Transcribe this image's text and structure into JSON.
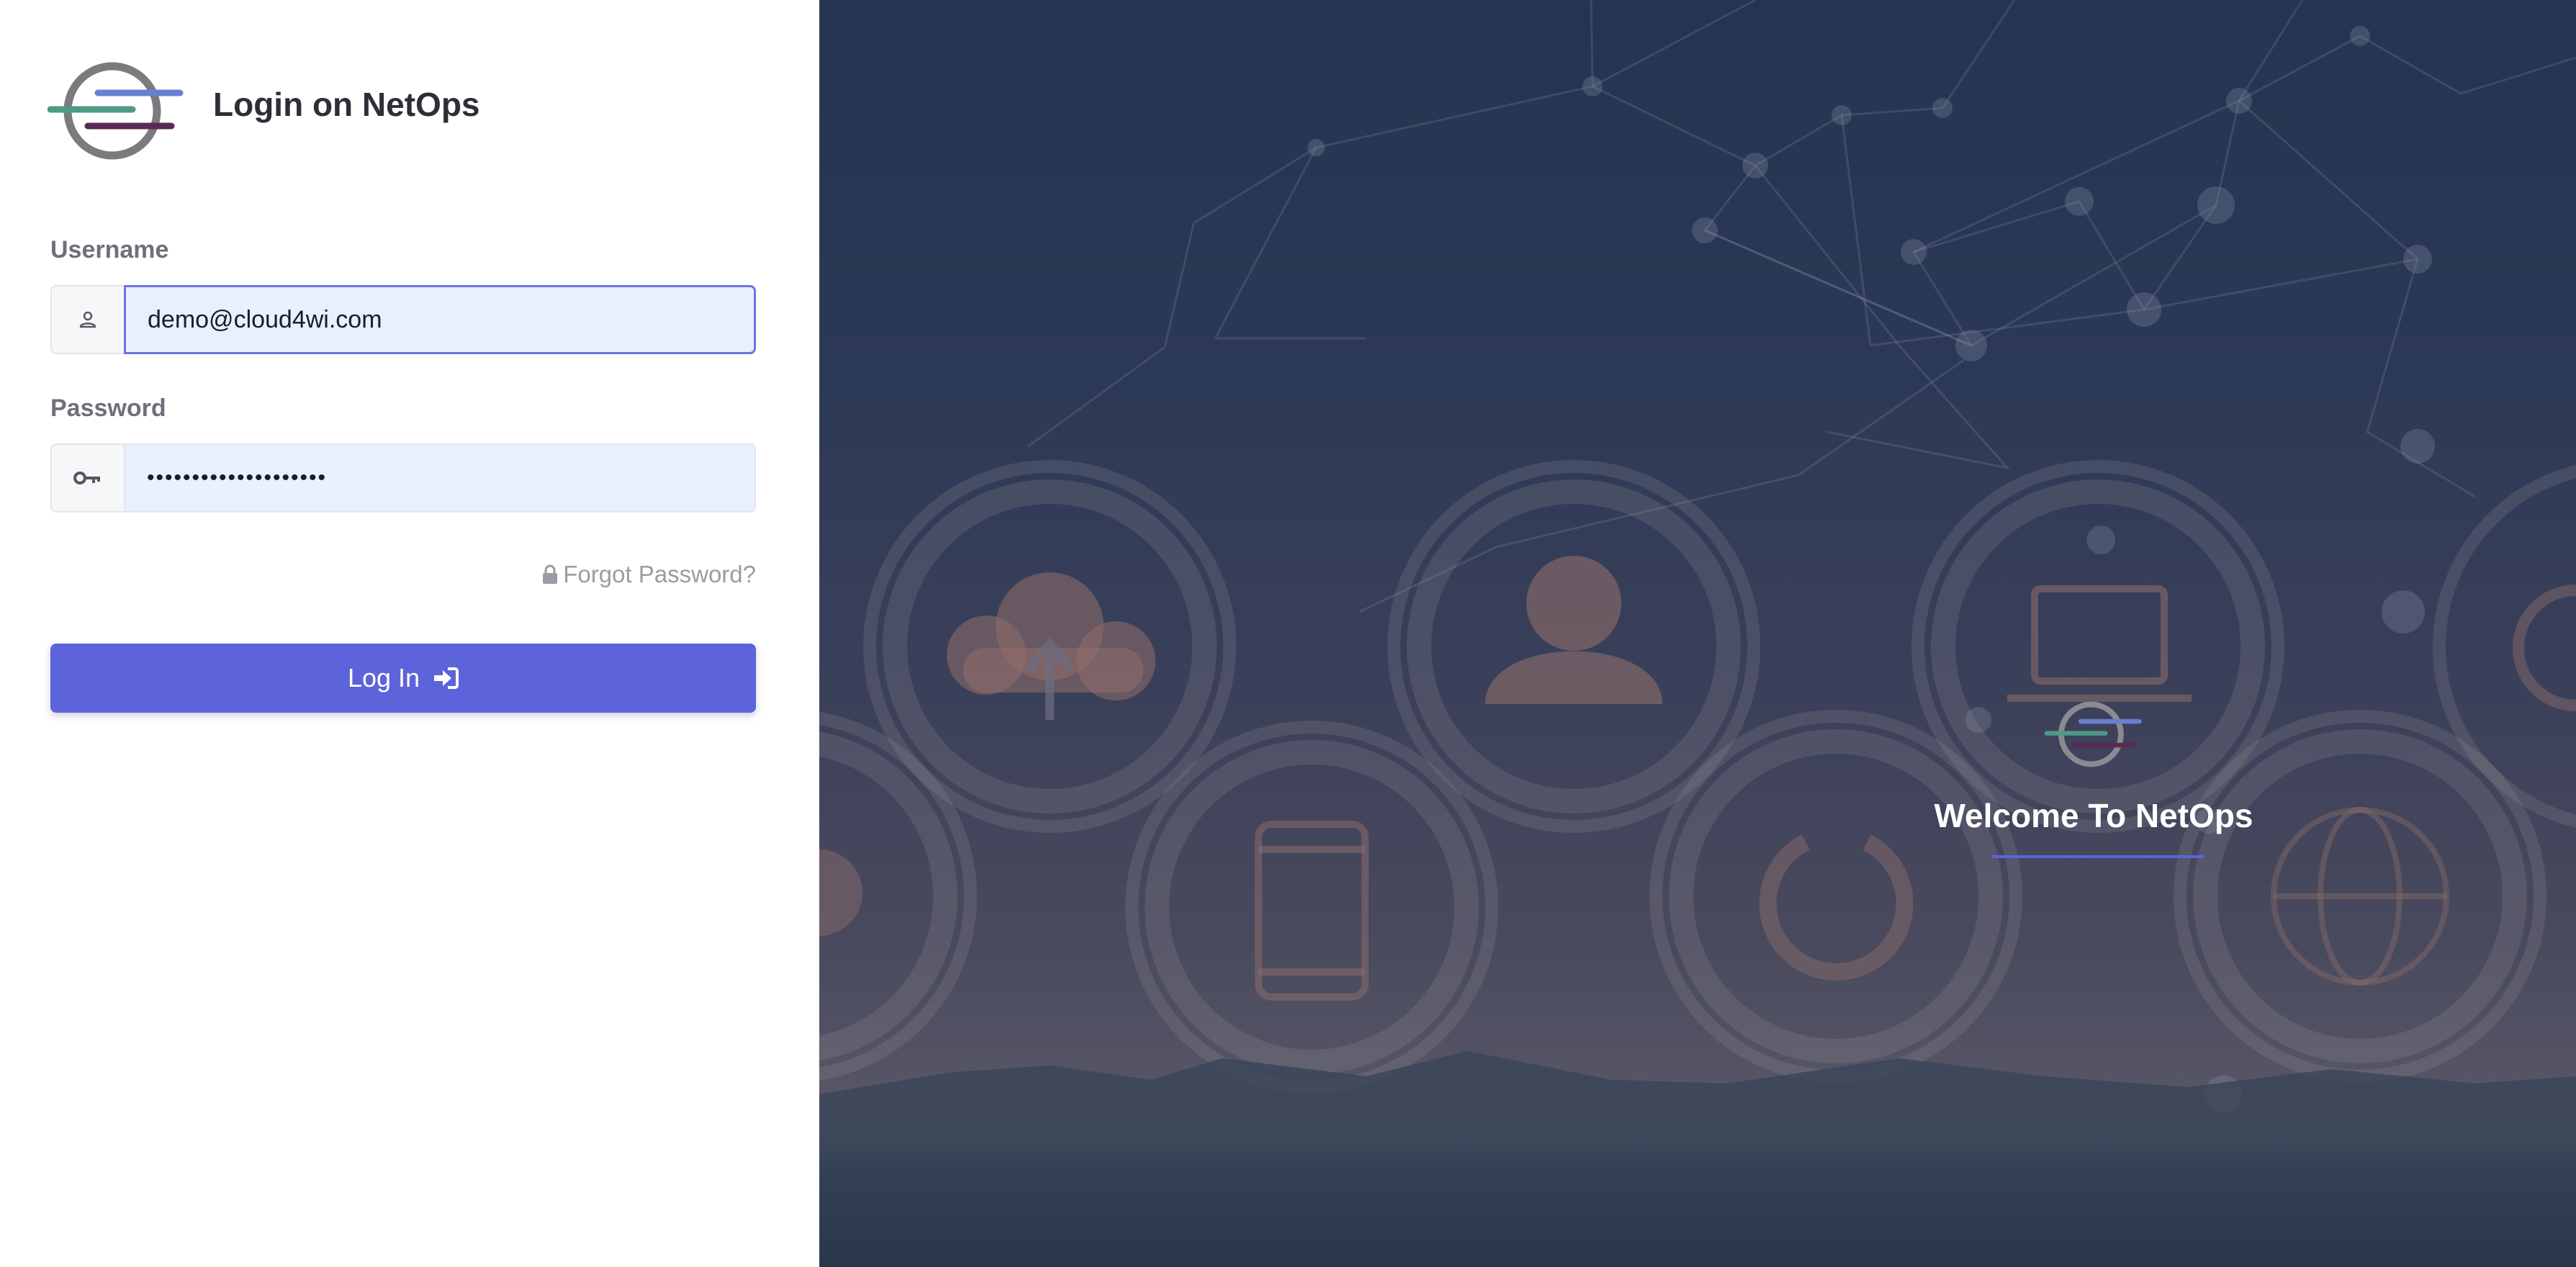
{
  "app": {
    "page_title": "Login on NetOps",
    "welcome_title": "Welcome To NetOps"
  },
  "form": {
    "username": {
      "label": "Username",
      "value": "demo@cloud4wi.com",
      "icon": "user-icon"
    },
    "password": {
      "label": "Password",
      "value": "••••••••••••••••••••",
      "icon": "key-icon"
    },
    "forgot_password": {
      "label": "Forgot Password?",
      "icon": "lock-icon"
    },
    "login_button": {
      "label": "Log In",
      "icon": "sign-in-icon"
    }
  },
  "colors": {
    "accent": "#5d63da",
    "logo_blue": "#6b7fd0",
    "logo_teal": "#4e9a86",
    "logo_purple": "#5a2b52",
    "logo_gray": "#7a7a7f"
  }
}
